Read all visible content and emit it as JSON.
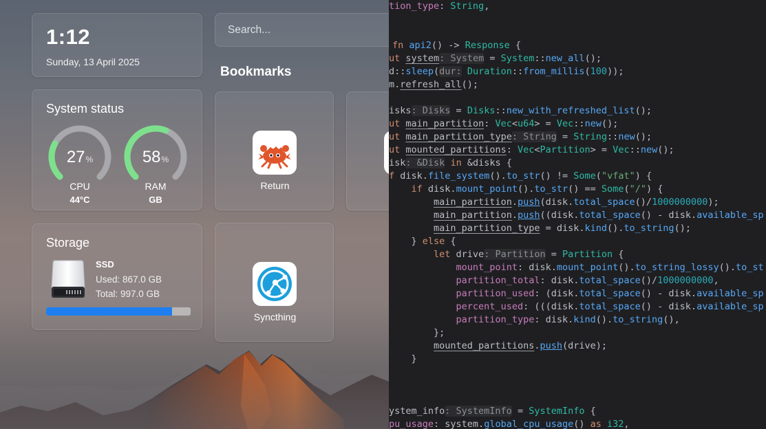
{
  "dashboard": {
    "clock": {
      "time": "1:12",
      "date": "Sunday, 13 April 2025"
    },
    "system_status": {
      "title": "System status",
      "cpu": {
        "value": "27",
        "unit": "%",
        "label": "CPU",
        "temp": "44°C",
        "percent": 0.27
      },
      "ram": {
        "value": "58",
        "unit": "%",
        "label": "RAM",
        "sub": "GB",
        "percent": 0.58
      }
    },
    "storage": {
      "title": "Storage",
      "name": "SSD",
      "used": "Used: 867.0 GB",
      "total": "Total: 997.0 GB",
      "percent": 0.87
    },
    "search": {
      "placeholder": "Search..."
    },
    "bookmarks": {
      "title": "Bookmarks",
      "items": [
        {
          "label": "Return",
          "icon": "ferris-crab-icon"
        },
        {
          "label": "Syncthing",
          "icon": "syncthing-icon"
        }
      ]
    },
    "colors": {
      "accent": "#1f7ff0",
      "gauge_track": "#a8a8ad",
      "gauge_green": "#7ee08c"
    }
  },
  "editor": {
    "colors": {
      "background": "#1f1f22",
      "keyword": "#cf8e6d",
      "function": "#56a8f5",
      "type": "#2fbaa3",
      "string": "#6aab73",
      "number": "#2aacb8",
      "property": "#c77dbb"
    }
  }
}
